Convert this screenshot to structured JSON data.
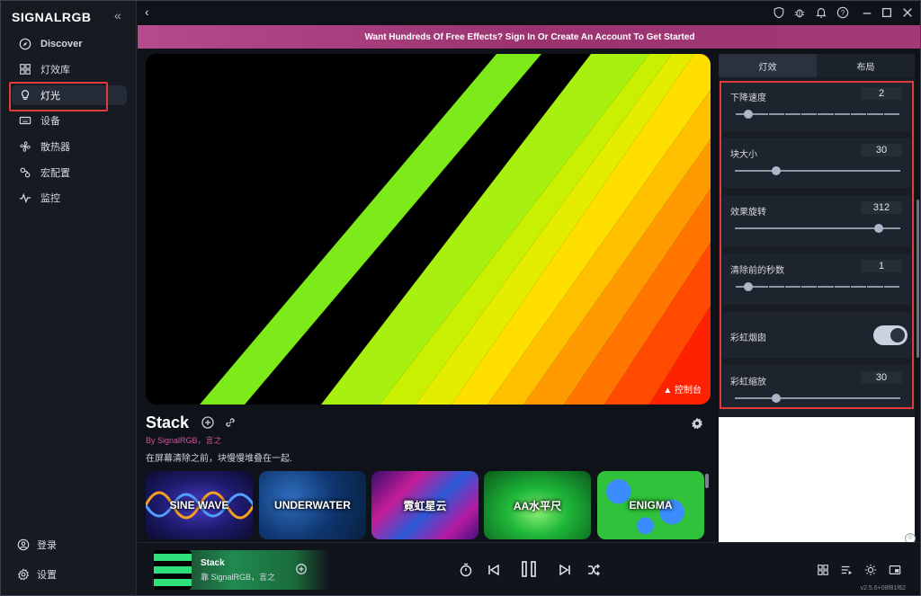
{
  "app": {
    "logo": "SIGNALRGB",
    "collapse_icon": "double-chevron-left-icon",
    "version": "v2.5.6+08f81f62"
  },
  "sidebar": {
    "items": [
      {
        "label": "Discover",
        "icon": "compass-icon"
      },
      {
        "label": "灯效库",
        "icon": "grid-icon"
      },
      {
        "label": "灯光",
        "icon": "bulb-icon"
      },
      {
        "label": "设备",
        "icon": "keyboard-icon"
      },
      {
        "label": "散热器",
        "icon": "fan-icon"
      },
      {
        "label": "宏配置",
        "icon": "macro-icon"
      },
      {
        "label": "监控",
        "icon": "pulse-icon"
      }
    ],
    "login_label": "登录",
    "settings_label": "设置"
  },
  "banner": {
    "text": "Want Hundreds Of Free Effects? Sign In Or Create An Account To Get Started",
    "color": "#9b3370"
  },
  "preview": {
    "console_label": "▲ 控制台"
  },
  "effect": {
    "title": "Stack",
    "author": "By SignalRGB，言之",
    "description": "在屏幕清除之前，块慢慢堆叠在一起."
  },
  "thumbnails": [
    {
      "label": "SINE WAVE"
    },
    {
      "label": "UNDERWATER"
    },
    {
      "label": "霓虹星云"
    },
    {
      "label": "AA水平尺"
    },
    {
      "label": "ENIGMA"
    }
  ],
  "panel": {
    "tabs": [
      "灯效",
      "布局"
    ],
    "props": [
      {
        "label": "下降速度",
        "value": "2",
        "level": 0.08
      },
      {
        "label": "块大小",
        "value": "30",
        "level": 0.25
      },
      {
        "label": "效果旋转",
        "value": "312",
        "level": 0.87
      },
      {
        "label": "清除前的秒数",
        "value": "1",
        "level": 0.08
      },
      {
        "label": "彩虹烟囱",
        "toggle": true
      },
      {
        "label": "彩虹缩放",
        "value": "30",
        "level": 0.25
      }
    ]
  },
  "now_playing": {
    "title": "Stack",
    "author": "靠 SignalRGB，言之"
  },
  "colors": {
    "highlight": "#e23b3b",
    "accent_green": "#1f8a4f"
  }
}
